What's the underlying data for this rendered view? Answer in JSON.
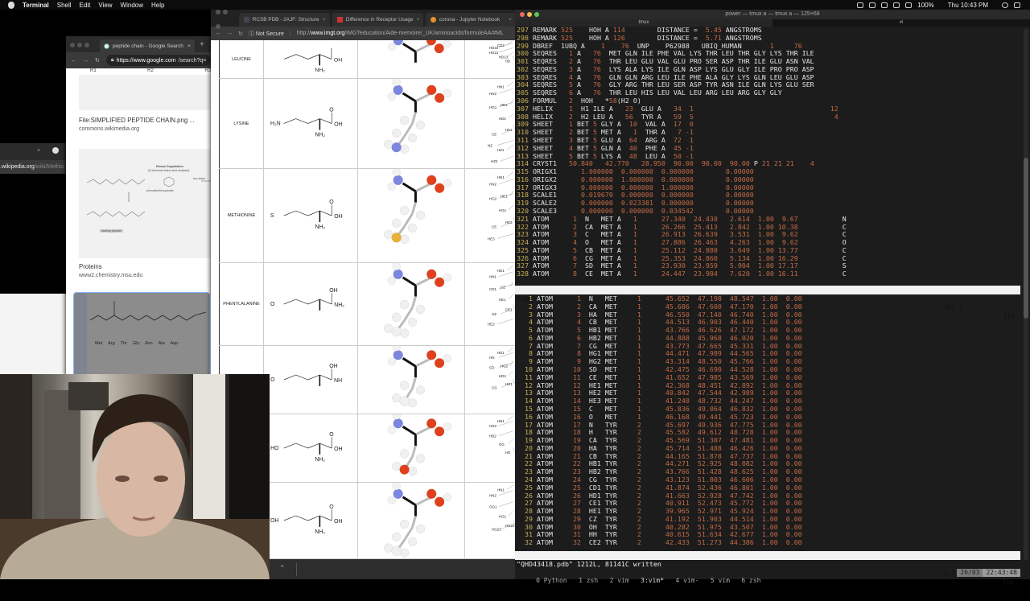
{
  "menubar": {
    "app": "Terminal",
    "items": [
      "Shell",
      "Edit",
      "View",
      "Window",
      "Help"
    ],
    "battery": "100%",
    "clock": "Thu 10:43 PM"
  },
  "google_window": {
    "tab_title": "peptide chain - Google Search",
    "url_host": "https://www.google.com",
    "url_rest": "/search?q=",
    "top_labels": [
      "R1",
      "R2",
      "R3"
    ],
    "results": [
      {
        "title": "File:SIMPLIFIED PEPTIDE CHAIN.png ...",
        "source": "commons.wikimedia.org"
      },
      {
        "title": "Proteins",
        "source": "www2.chemistry.msu.edu",
        "image_text": {
          "heading": "Edman Degradation",
          "subheading": "(N-terminal amino acid analysis)",
          "reagent": "phenylisothiocyanate",
          "arrow": "two steps",
          "label": "starting peptide"
        }
      },
      {
        "image_text": {
          "residues": [
            "Met",
            "Arg",
            "Thr",
            "Gly",
            "Asn",
            "Ala",
            "Asp"
          ]
        }
      }
    ]
  },
  "wiki_window": {
    "url_host": ".wikipedia.org",
    "url_rest": "/wiki/Methio"
  },
  "imgt_window": {
    "tabs": [
      {
        "title": "RCSB PDB - 2AJF: Structure",
        "icon": "pdb-icon"
      },
      {
        "title": "Difference in Receptor Usage",
        "icon": "pdf-icon"
      },
      {
        "title": "corona - Jupyter Notebook",
        "icon": "jupyter-icon"
      }
    ],
    "security": "Not Secure",
    "url_scheme": "http://",
    "url_host": "www.imgt.org",
    "url_rest": "/IMGTeducation/Aide-memoire/_UK/aminoacids/formuleAA/#ML",
    "rows": [
      {
        "name": "LEUCINE",
        "formula_labels": [
          "OH",
          "NH₂"
        ],
        "atom_labels": [
          "HD22",
          "CD2",
          "HD21",
          "HD13",
          "HD"
        ]
      },
      {
        "name": "LYSINE",
        "formula_labels": [
          "H₂N",
          "O",
          "OH",
          "NH₂"
        ],
        "atom_labels": [
          "HN2",
          "HN1",
          "HG1",
          "HD2",
          "HE1",
          "CE",
          "HE2",
          "NZ",
          "HZ1",
          "HZ2"
        ]
      },
      {
        "name": "METHIONINE",
        "formula_labels": [
          "S",
          "O",
          "OH",
          "NH₂"
        ],
        "atom_labels": [
          "HN2",
          "HN1",
          "HG2",
          "HG1",
          "HE2",
          "CE",
          "HE1",
          "HE3"
        ]
      },
      {
        "name": "PHENYLALANINE",
        "formula_labels": [
          "O",
          "OH",
          "NH₂"
        ],
        "atom_labels": [
          "HN1",
          "HD1",
          "CD1",
          "HE1",
          "CE1",
          "HZ",
          "CZ",
          "HE2"
        ]
      },
      {
        "name": "",
        "formula_labels": [
          "O",
          "OH",
          "NH"
        ],
        "atom_labels": [
          "HN",
          "HD1",
          "CD",
          "HD2",
          "HG1",
          "CG",
          "HG2"
        ]
      },
      {
        "name": "",
        "formula_labels": [
          "HO",
          "O",
          "OH",
          "NH₂"
        ],
        "atom_labels": [
          "HN2",
          "HN1",
          "HB2",
          "OG",
          "HG"
        ]
      },
      {
        "name": "",
        "formula_labels": [
          "OH",
          "O",
          "OH",
          "NH₂"
        ],
        "atom_labels": [
          "HN2",
          "HN1",
          "OG1",
          "HG1",
          "HG22",
          "HG23"
        ]
      }
    ],
    "scroll_top_icon": "chevron-up-icon"
  },
  "terminal": {
    "window_title": "power — tmux a — tmux a — 125×68",
    "tabs": [
      "tmux",
      "vi"
    ],
    "top_pane": {
      "first_line_number": 297,
      "lines": [
        "REMARK 525    HOH A 114        DISTANCE =  5.45 ANGSTROMS",
        "REMARK 525    HOH A 126        DISTANCE =  5.71 ANGSTROMS",
        "DBREF  1UBQ A    1    76  UNP    P62988   UBIQ_HUMAN       1     76",
        "SEQRES   1 A   76  MET GLN ILE PHE VAL LYS THR LEU THR GLY LYS THR ILE",
        "SEQRES   2 A   76  THR LEU GLU VAL GLU PRO SER ASP THR ILE GLU ASN VAL",
        "SEQRES   3 A   76  LYS ALA LYS ILE GLN ASP LYS GLU GLY ILE PRO PRO ASP",
        "SEQRES   4 A   76  GLN GLN ARG LEU ILE PHE ALA GLY LYS GLN LEU GLU ASP",
        "SEQRES   5 A   76  GLY ARG THR LEU SER ASP TYR ASN ILE GLN LYS GLU SER",
        "SEQRES   6 A   76  THR LEU HIS LEU VAL LEU ARG LEU ARG GLY GLY",
        "FORMUL   2  HOH   *58(H2 O)",
        "HELIX    1  H1 ILE A   23  GLU A   34  1                                  12",
        "HELIX    2  H2 LEU A   56  TYR A   59  5                                   4",
        "SHEET    1 BET 5 GLY A  10  VAL A  17  0",
        "SHEET    2 BET 5 MET A   1  THR A   7 -1",
        "SHEET    3 BET 5 GLU A  64  ARG A  72  1",
        "SHEET    4 BET 5 GLN A  40  PHE A  45 -1",
        "SHEET    5 BET 5 LYS A  48  LEU A  50 -1",
        "CRYST1   50.840   42.770   28.950  90.00  90.00  90.00 P 21 21 21    4",
        "ORIGX1      1.000000  0.000000  0.000000        0.00000",
        "ORIGX2      0.000000  1.000000  0.000000        0.00000",
        "ORIGX3      0.000000  0.000000  1.000000        0.00000",
        "SCALE1      0.019670  0.000000  0.000000        0.00000",
        "SCALE2      0.000000  0.023381  0.000000        0.00000",
        "SCALE3      0.000000  0.000000  0.034542        0.00000",
        "ATOM      1  N   MET A   1      27.340  24.430   2.614  1.00  9.67           N",
        "ATOM      2  CA  MET A   1      26.266  25.413   2.842  1.00 10.38           C",
        "ATOM      3  C   MET A   1      26.913  26.639   3.531  1.00  9.62           C",
        "ATOM      4  O   MET A   1      27.886  26.463   4.263  1.00  9.62           O",
        "ATOM      5  CB  MET A   1      25.112  24.880   3.649  1.00 13.77           C",
        "ATOM      6  CG  MET A   1      25.353  24.860   5.134  1.00 16.29           C",
        "ATOM      7  SD  MET A   1      23.930  23.959   5.904  1.00 17.17           S",
        "ATOM      8  CE  MET A   1      24.447  23.984   7.620  1.00 16.11           C"
      ],
      "status": {
        "file": "1ubq.pdb",
        "position": "301,1",
        "percent": "31%"
      }
    },
    "bottom_pane": {
      "first_line_number": 1,
      "lines": [
        "ATOM      1  N   MET     1      45.652  47.198  48.547  1.00  0.00",
        "ATOM      2  CA  MET     1      45.686  47.600  47.170  1.00  0.00",
        "ATOM      3  HA  MET     1      46.550  47.140  46.740  1.00  0.00",
        "ATOM      4  CB  MET     1      44.513  46.903  46.440  1.00  0.00",
        "ATOM      5  HB1 MET     1      43.766  46.626  47.172  1.00  0.00",
        "ATOM      6  HB2 MET     1      44.888  45.968  46.020  1.00  0.00",
        "ATOM      7  CG  MET     1      43.773  47.665  45.331  1.00  0.00",
        "ATOM      8  HG1 MET     1      44.471  47.989  44.565  1.00  0.00",
        "ATOM      9  HG2 MET     1      43.314  48.550  45.766  1.00  0.00",
        "ATOM     10  SD  MET     1      42.475  46.690  44.528  1.00  0.00",
        "ATOM     11  CE  MET     1      41.652  47.985  43.569  1.00  0.00",
        "ATOM     12  HE1 MET     1      42.368  48.451  42.892  1.00  0.00",
        "ATOM     13  HE2 MET     1      40.842  47.544  42.989  1.00  0.00",
        "ATOM     14  HE3 MET     1      41.240  48.732  44.247  1.00  0.00",
        "ATOM     15  C   MET     1      45.836  49.064  46.832  1.00  0.00",
        "ATOM     16  O   MET     1      46.168  49.441  45.723  1.00  0.00",
        "ATOM     17  N   TYR     2      45.697  49.936  47.775  1.00  0.00",
        "ATOM     18  H   TYR     2      45.582  49.612  48.728  1.00  0.00",
        "ATOM     19  CA  TYR     2      45.569  51.307  47.481  1.00  0.00",
        "ATOM     20  HA  TYR     2      45.714  51.488  46.426  1.00  0.00",
        "ATOM     21  CB  TYR     2      44.165  51.878  47.737  1.00  0.00",
        "ATOM     22  HB1 TYR     2      44.271  52.925  48.082  1.00  0.00",
        "ATOM     23  HB2 TYR     2      43.766  51.428  48.625  1.00  0.00",
        "ATOM     24  CG  TYR     2      43.123  51.803  46.606  1.00  0.00",
        "ATOM     25  CD1 TYR     2      41.874  52.436  46.801  1.00  0.00",
        "ATOM     26  HD1 TYR     2      41.663  52.928  47.742  1.00  0.00",
        "ATOM     27  CE1 TYR     2      40.911  52.473  45.772  1.00  0.00",
        "ATOM     28  HE1 TYR     2      39.965  52.971  45.924  1.00  0.00",
        "ATOM     29  CZ  TYR     2      41.192  51.903  44.514  1.00  0.00",
        "ATOM     30  OH  TYR     2      40.282  51.975  43.507  1.00  0.00",
        "ATOM     31  HH  TYR     2      40.615  51.634  42.677  1.00  0.00",
        "ATOM     32  CE2 TYR     2      42.433  51.273  44.386  1.00  0.00"
      ],
      "status": {
        "file": "QHD43418.pdb",
        "position": "2,1",
        "percent": "Top"
      }
    },
    "message": "\"QHD43418.pdb\" 1212L, 81141C written",
    "tmux_windows": [
      "0 Python",
      "1 zsh",
      "2 vim",
      "3:vim*",
      "4 vim-",
      "5 vim",
      "6 zsh"
    ],
    "tmux_date": "26/03",
    "tmux_time": "22:43:48"
  },
  "colors": {
    "number": "#c46b45",
    "line_number": "#c9b25a",
    "nitrogen": "#7b86e0",
    "oxygen": "#e0401c",
    "sulfur": "#e8b13a"
  }
}
